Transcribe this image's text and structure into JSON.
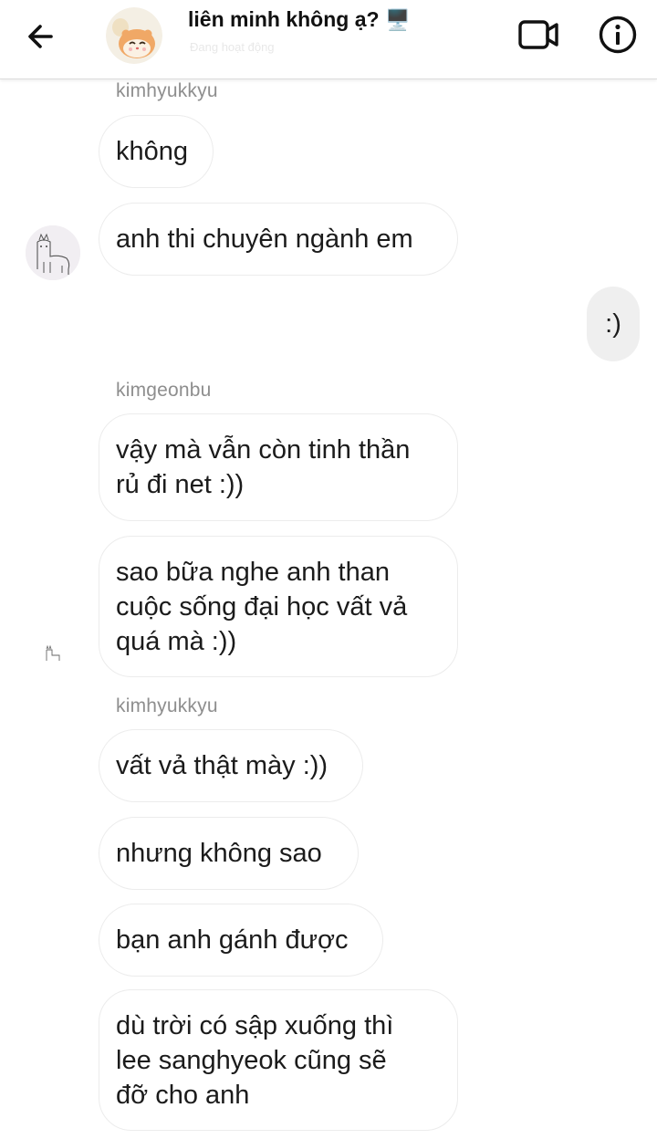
{
  "header": {
    "title": "liên minh không ạ?",
    "title_emoji": "🖥️",
    "subtitle": "Đang hoạt động",
    "icons": [
      "back-arrow-icon",
      "video-call-icon",
      "info-icon"
    ]
  },
  "messages": [
    {
      "sender": "kimhyukkyu",
      "text": "không"
    },
    {
      "text": "anh thi chuyên ngành em"
    },
    {
      "mine": true,
      "text": ":)"
    },
    {
      "sender": "kimgeonbu",
      "text": "vậy mà vẫn còn tinh thần\nrủ đi net :))"
    },
    {
      "text": "sao bữa nghe anh than\ncuộc sống đại học vất vả\nquá mà :))"
    },
    {
      "sender": "kimhyukkyu",
      "text": "vất vả thật mày :))"
    },
    {
      "text": "nhưng không sao"
    },
    {
      "text": "bạn anh gánh được"
    },
    {
      "text": "dù trời có sập xuống thì\nlee sanghyeok cũng sẽ\nđỡ cho anh"
    }
  ],
  "colors": {
    "bubble_border": "#ececec",
    "my_bubble_bg": "#efefef",
    "sender_label": "#8e8e8e",
    "text": "#1b1b1b"
  }
}
